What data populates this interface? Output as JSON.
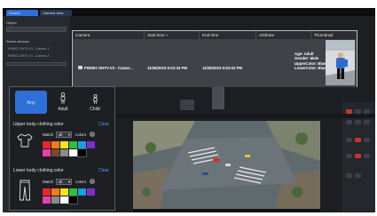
{
  "app": {
    "tabs": [
      "Search",
      "Camera view"
    ]
  },
  "left_panel": {
    "object_label": "Object",
    "select_devices_label": "Select devices",
    "device_rows": [
      "P09097-SHTV-V3 - Camera 1",
      "P09097-SHTV-V3 - Camera 2"
    ]
  },
  "results": {
    "columns": [
      "Camera",
      "Start time",
      "End time",
      "Attribute",
      "Thumbnail"
    ],
    "sort_indicator": "▾",
    "rows": [
      {
        "camera": "P09097-SHTV-V3 - Camer...",
        "start_time": "11/26/2023 5:03:33 PM",
        "end_time": "11/26/2023 5:04:02 PM",
        "attributes": [
          "Age: Adult",
          "Gender: Male",
          "UpperColor: Blue",
          "LowerColor: Black"
        ]
      }
    ]
  },
  "filter": {
    "age_options": [
      {
        "label": "Any",
        "selected": true
      },
      {
        "label": "Adult",
        "selected": false,
        "icon": "adult-icon"
      },
      {
        "label": "Child",
        "selected": false,
        "icon": "child-icon"
      }
    ],
    "upper": {
      "title": "Upper body clothing color",
      "clear": "Clear",
      "match_label": "Match",
      "match_value": "all",
      "colors_label": "colors",
      "swatches": [
        "#e8262b",
        "#f27a1a",
        "#f7e51a",
        "#2fbf3a",
        "#1b9ee8",
        "#7b2fd1",
        "#e83fb0",
        "#7a4a24",
        "#8a8a8a",
        "#ffffff",
        "#000000"
      ]
    },
    "lower": {
      "title": "Lower body clothing color",
      "clear": "Clear",
      "match_label": "Match",
      "match_value": "all",
      "colors_label": "colors",
      "swatches": [
        "#e8262b",
        "#f27a1a",
        "#f7e51a",
        "#2fbf3a",
        "#1b9ee8",
        "#7b2fd1",
        "#e83fb0",
        "#8a8a8a",
        "#ffffff",
        "#000000"
      ]
    }
  }
}
